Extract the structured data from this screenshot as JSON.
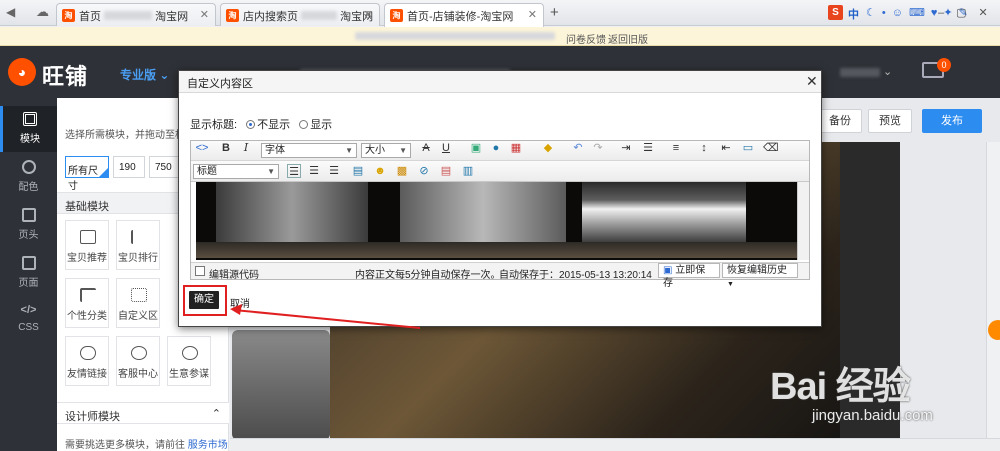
{
  "browser": {
    "tabs": [
      {
        "label": "首页",
        "label2": "淘宝网"
      },
      {
        "label": "店内搜索页",
        "label2": "淘宝网"
      },
      {
        "label": "首页-店铺装修-淘宝网"
      }
    ],
    "new_tab": "+",
    "notice_links": [
      "问卷反馈",
      "返回旧版"
    ],
    "search_logo": "S",
    "ime_label": "中"
  },
  "app": {
    "brand": "旺铺",
    "edition": "专业版",
    "mail_count": "0",
    "actions": {
      "backup": "备份",
      "preview": "预览",
      "publish": "发布"
    }
  },
  "sidebar": {
    "items": [
      {
        "label": "模块"
      },
      {
        "label": "配色"
      },
      {
        "label": "页头"
      },
      {
        "label": "页面"
      },
      {
        "label": "CSS"
      }
    ]
  },
  "panel": {
    "hint": "选择所需模块，并拖动至相应",
    "size_filter": {
      "all": "所有尺寸",
      "w1": "190",
      "w2": "750"
    },
    "basic_title": "基础模块",
    "modules": [
      "宝贝推荐",
      "宝贝排行",
      "个性分类",
      "自定义区",
      "友情链接",
      "客服中心",
      "生意参谋"
    ],
    "designer_title": "设计师模块",
    "designer_hint": "需要挑选更多模块，请前往",
    "designer_link": "服务市场"
  },
  "dialog": {
    "title": "自定义内容区",
    "show_title_label": "显示标题:",
    "radio_hide": "不显示",
    "radio_show": "显示",
    "font_select": "字体",
    "size_select": "大小",
    "heading_select": "标题",
    "source_code": "编辑源代码",
    "autosave_note": "内容正文每5分钟自动保存一次。",
    "autosave_time": "自动保存于：2015-05-13 13:20:14",
    "save_now": "立即保存",
    "restore": "恢复编辑历史",
    "ok": "确定",
    "cancel": "取消"
  },
  "watermark": {
    "main": "Bai 经验",
    "sub": "jingyan.baidu.com"
  },
  "colors": {
    "accent": "#2d8cf0",
    "brand": "#ff5000",
    "highlight": "#e02020"
  }
}
